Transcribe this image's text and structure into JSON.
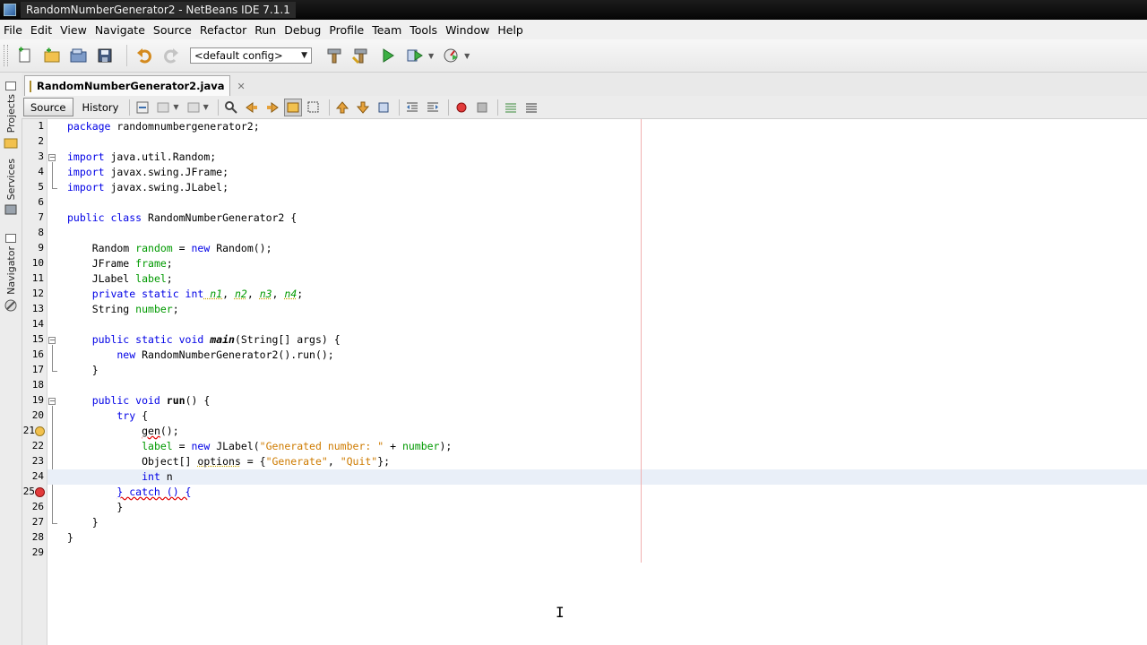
{
  "window": {
    "title": "RandomNumberGenerator2 - NetBeans IDE 7.1.1"
  },
  "menu": [
    "File",
    "Edit",
    "View",
    "Navigate",
    "Source",
    "Refactor",
    "Run",
    "Debug",
    "Profile",
    "Team",
    "Tools",
    "Window",
    "Help"
  ],
  "toolbar": {
    "config_value": "<default config>"
  },
  "side_tabs": {
    "projects": "Projects",
    "services": "Services",
    "navigator": "Navigator"
  },
  "editor": {
    "file_tab": "RandomNumberGenerator2.java",
    "source_label": "Source",
    "history_label": "History",
    "line_numbers": [
      "1",
      "2",
      "3",
      "4",
      "5",
      "6",
      "7",
      "8",
      "9",
      "10",
      "11",
      "12",
      "13",
      "14",
      "15",
      "16",
      "17",
      "18",
      "19",
      "20",
      "21",
      "22",
      "23",
      "24",
      "25",
      "26",
      "27",
      "28",
      "29"
    ]
  },
  "code": {
    "l1": "package randomnumbergenerator2;",
    "l3a": "import",
    "l3b": " java.util.Random;",
    "l4a": "import",
    "l4b": " javax.swing.JFrame;",
    "l5a": "import",
    "l5b": " javax.swing.JLabel;",
    "l7a": "public class",
    "l7b": " RandomNumberGenerator2 {",
    "l9a": "    Random ",
    "l9b": "random",
    "l9c": " = ",
    "l9d": "new",
    "l9e": " Random();",
    "l10a": "    JFrame ",
    "l10b": "frame",
    "l10c": ";",
    "l11a": "    JLabel ",
    "l11b": "label",
    "l11c": ";",
    "l12a": "    private static int",
    "l12b": " n1",
    "l12c": ", ",
    "l12d": "n2",
    "l12e": ", ",
    "l12f": "n3",
    "l12g": ", ",
    "l12h": "n4",
    "l12i": ";",
    "l13a": "    String ",
    "l13b": "number",
    "l13c": ";",
    "l15a": "    public static void",
    "l15b": " main",
    "l15c": "(String[] args) {",
    "l16a": "        new",
    "l16b": " RandomNumberGenerator2().run();",
    "l17": "    }",
    "l19a": "    public void",
    "l19b": " run",
    "l19c": "() {",
    "l20a": "        try",
    "l20b": " {",
    "l21a": "            ",
    "l21b": "gen",
    "l21c": "();",
    "l22a": "            ",
    "l22b": "label",
    "l22c": " = ",
    "l22d": "new",
    "l22e": " JLabel(",
    "l22f": "\"Generated number: \"",
    "l22g": " + ",
    "l22h": "number",
    "l22i": ");",
    "l23a": "            Object[] ",
    "l23b": "options",
    "l23c": " = {",
    "l23d": "\"Generate\"",
    "l23e": ", ",
    "l23f": "\"Quit\"",
    "l23g": "};",
    "l24a": "            ",
    "l24b": "int",
    "l24c": " n",
    "l25a": "        ",
    "l25b": "} catch () {",
    "l26": "        }",
    "l27": "    }",
    "l28": "}"
  }
}
